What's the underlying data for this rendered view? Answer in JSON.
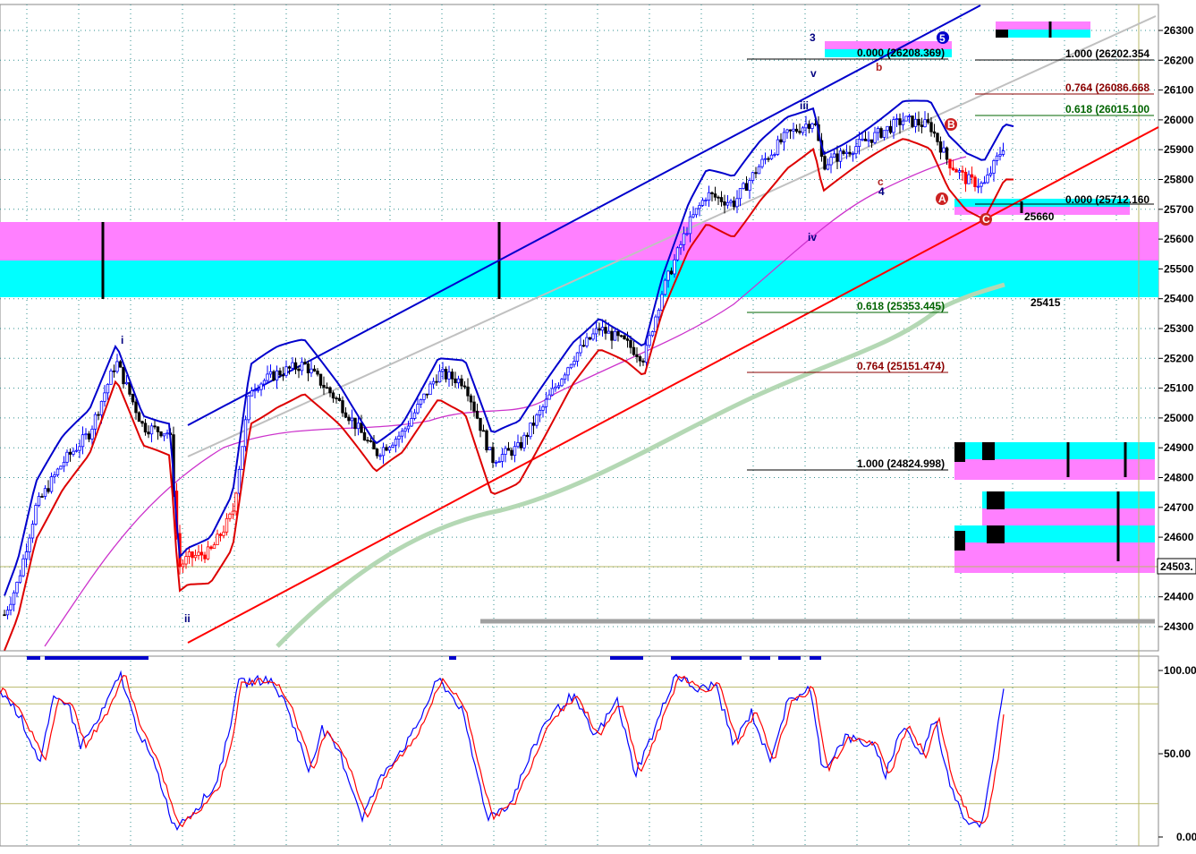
{
  "chart_data": {
    "type": "candlestick",
    "price_axis": {
      "ticks": [
        26300,
        26200,
        26100,
        26000,
        25900,
        25800,
        25700,
        25600,
        25500,
        25400,
        25300,
        25200,
        25100,
        25000,
        24900,
        24800,
        24700,
        24600,
        24500,
        24400,
        24300
      ],
      "range": [
        24220,
        26400
      ],
      "current_price_label": "24503."
    },
    "oscillator_axis": {
      "ticks": [
        "100.00",
        "50.00",
        "0.00"
      ],
      "range": [
        0,
        100
      ],
      "levels": [
        90,
        80,
        20
      ]
    },
    "fib_levels": [
      {
        "ratio": "0.000",
        "value": "26208.369",
        "color": "#000000"
      },
      {
        "ratio": "1.000",
        "value": "26202.354",
        "color": "#000000"
      },
      {
        "ratio": "0.764",
        "value": "26086.668",
        "color": "#8b0000"
      },
      {
        "ratio": "0.618",
        "value": "26015.100",
        "color": "#006400"
      },
      {
        "ratio": "0.000",
        "value": "25712.160",
        "color": "#000000"
      },
      {
        "ratio": "0.618",
        "value": "25353.445",
        "color": "#006400"
      },
      {
        "ratio": "0.764",
        "value": "25151.474",
        "color": "#8b0000"
      },
      {
        "ratio": "1.000",
        "value": "24824.998",
        "color": "#000000"
      }
    ],
    "price_annotations": [
      "25660",
      "25415"
    ],
    "wave_labels": [
      {
        "text": "i",
        "color": "#000080"
      },
      {
        "text": "ii",
        "color": "#000080"
      },
      {
        "text": "iii",
        "color": "#000080"
      },
      {
        "text": "iv",
        "color": "#000080"
      },
      {
        "text": "v",
        "color": "#000080"
      },
      {
        "text": "3",
        "color": "#000080"
      },
      {
        "text": "4",
        "color": "#000080"
      },
      {
        "text": "5",
        "color": "#000080"
      },
      {
        "text": "b",
        "color": "#b22222"
      },
      {
        "text": "c",
        "color": "#b22222"
      },
      {
        "text": "A",
        "color": "#b22222"
      },
      {
        "text": "B",
        "color": "#b22222"
      },
      {
        "text": "C",
        "color": "#b22222"
      }
    ],
    "colors": {
      "up_candle": "#0000ff",
      "down_candle": "#000000",
      "red_candle": "#ff0000",
      "upper_channel": "#0000cc",
      "lower_channel": "#ff0000",
      "ema_fast_blue": "#0000cc",
      "ema_fast_red": "#dd0000",
      "ma_magenta": "#cc33cc",
      "ma_green": "#b4d8b4",
      "zone_magenta": "#ff80ff",
      "zone_cyan": "#00ffff",
      "grid": "#2f8f8f",
      "stoch_blue": "#0000ff",
      "stoch_red": "#ff0000"
    }
  }
}
